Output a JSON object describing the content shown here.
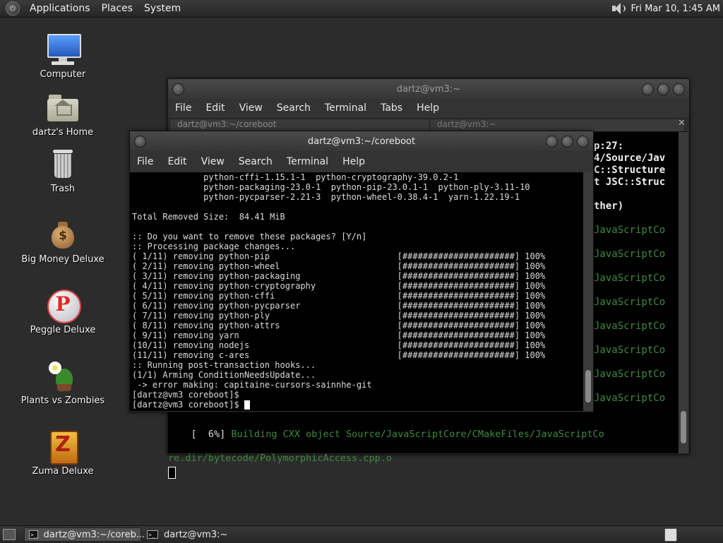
{
  "top_panel": {
    "menus": [
      "Applications",
      "Places",
      "System"
    ],
    "clock": "Fri Mar 10,  1:45 AM"
  },
  "desktop_icons": [
    {
      "label": "Computer",
      "icon": "computer-icon"
    },
    {
      "label": "dartz's Home",
      "icon": "home-folder-icon"
    },
    {
      "label": "Trash",
      "icon": "trash-icon"
    },
    {
      "label": "Big Money Deluxe",
      "icon": "money-bag-icon"
    },
    {
      "label": "Peggle Deluxe",
      "icon": "peggle-icon"
    },
    {
      "label": "Plants vs Zombies",
      "icon": "plants-vs-zombies-icon"
    },
    {
      "label": "Zuma Deluxe",
      "icon": "zuma-icon"
    }
  ],
  "back_window": {
    "title": "dartz@vm3:~",
    "menus": [
      "File",
      "Edit",
      "View",
      "Search",
      "Terminal",
      "Tabs",
      "Help"
    ],
    "tabs": [
      "dartz@vm3:~/coreboot",
      "dartz@vm3:~"
    ],
    "right_lines": [
      "p:27:",
      "4/Source/Jav",
      "C::Structure",
      "t JSC::Struc",
      "",
      "ther)",
      "",
      "JavaScriptCo",
      "",
      "JavaScriptCo",
      "",
      "JavaScriptCo",
      "",
      "JavaScriptCo",
      "",
      "JavaScriptCo",
      "",
      "JavaScriptCo",
      "",
      "JavaScriptCo",
      "",
      "JavaScriptCo"
    ],
    "bottom_lines": [
      "[  6%] Building CXX object Source/JavaScriptCore/CMakeFiles/JavaScriptCo",
      "re.dir/bytecode/PolymorphicAccess.cpp.o"
    ]
  },
  "front_window": {
    "title": "dartz@vm3:~/coreboot",
    "menus": [
      "File",
      "Edit",
      "View",
      "Search",
      "Terminal",
      "Help"
    ],
    "lines": [
      "              python-cffi-1.15.1-1  python-cryptography-39.0.2-1",
      "              python-packaging-23.0-1  python-pip-23.0.1-1  python-ply-3.11-10",
      "              python-pycparser-2.21-3  python-wheel-0.38.4-1  yarn-1.22.19-1",
      "",
      "Total Removed Size:  84.41 MiB",
      "",
      ":: Do you want to remove these packages? [Y/n]",
      ":: Processing package changes...",
      "( 1/11) removing python-pip                         [######################] 100%",
      "( 2/11) removing python-wheel                       [######################] 100%",
      "( 3/11) removing python-packaging                   [######################] 100%",
      "( 4/11) removing python-cryptography                [######################] 100%",
      "( 5/11) removing python-cffi                        [######################] 100%",
      "( 6/11) removing python-pycparser                   [######################] 100%",
      "( 7/11) removing python-ply                         [######################] 100%",
      "( 8/11) removing python-attrs                       [######################] 100%",
      "( 9/11) removing yarn                               [######################] 100%",
      "(10/11) removing nodejs                             [######################] 100%",
      "(11/11) removing c-ares                             [######################] 100%",
      ":: Running post-transaction hooks...",
      "(1/1) Arming ConditionNeedsUpdate...",
      " -> error making: capitaine-cursors-sainnhe-git",
      "[dartz@vm3 coreboot]$",
      "[dartz@vm3 coreboot]$ "
    ]
  },
  "taskbar": {
    "items": [
      "dartz@vm3:~/coreb...",
      "dartz@vm3:~"
    ]
  }
}
